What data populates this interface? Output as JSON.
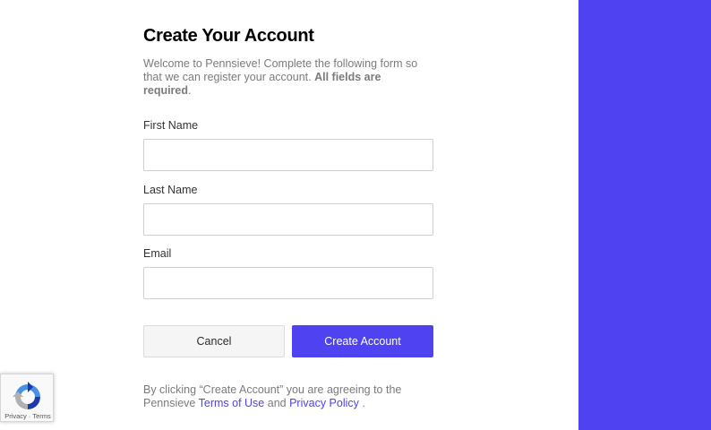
{
  "form": {
    "title": "Create Your Account",
    "intro_text": "Welcome to Pennsieve! Complete the following form so that we can register your account.",
    "intro_bold": "All fields are required",
    "intro_end": ".",
    "fields": [
      {
        "label": "First Name",
        "value": "",
        "placeholder": ""
      },
      {
        "label": "Last Name",
        "value": "",
        "placeholder": ""
      },
      {
        "label": "Email",
        "value": "",
        "placeholder": ""
      }
    ],
    "cancel_label": "Cancel",
    "create_label": "Create Account",
    "terms_prefix": "By clicking “Create Account” you are agreeing to the Pennsieve",
    "terms_link": "Terms of Use",
    "terms_and": "and",
    "privacy_link": "Privacy Policy",
    "terms_end": "."
  },
  "recaptcha": {
    "privacy": "Privacy",
    "separator": "·",
    "terms": "Terms",
    "icon": "recaptcha-icon"
  },
  "colors": {
    "accent": "#4f42f0",
    "side_panel": "#4f42f0"
  }
}
